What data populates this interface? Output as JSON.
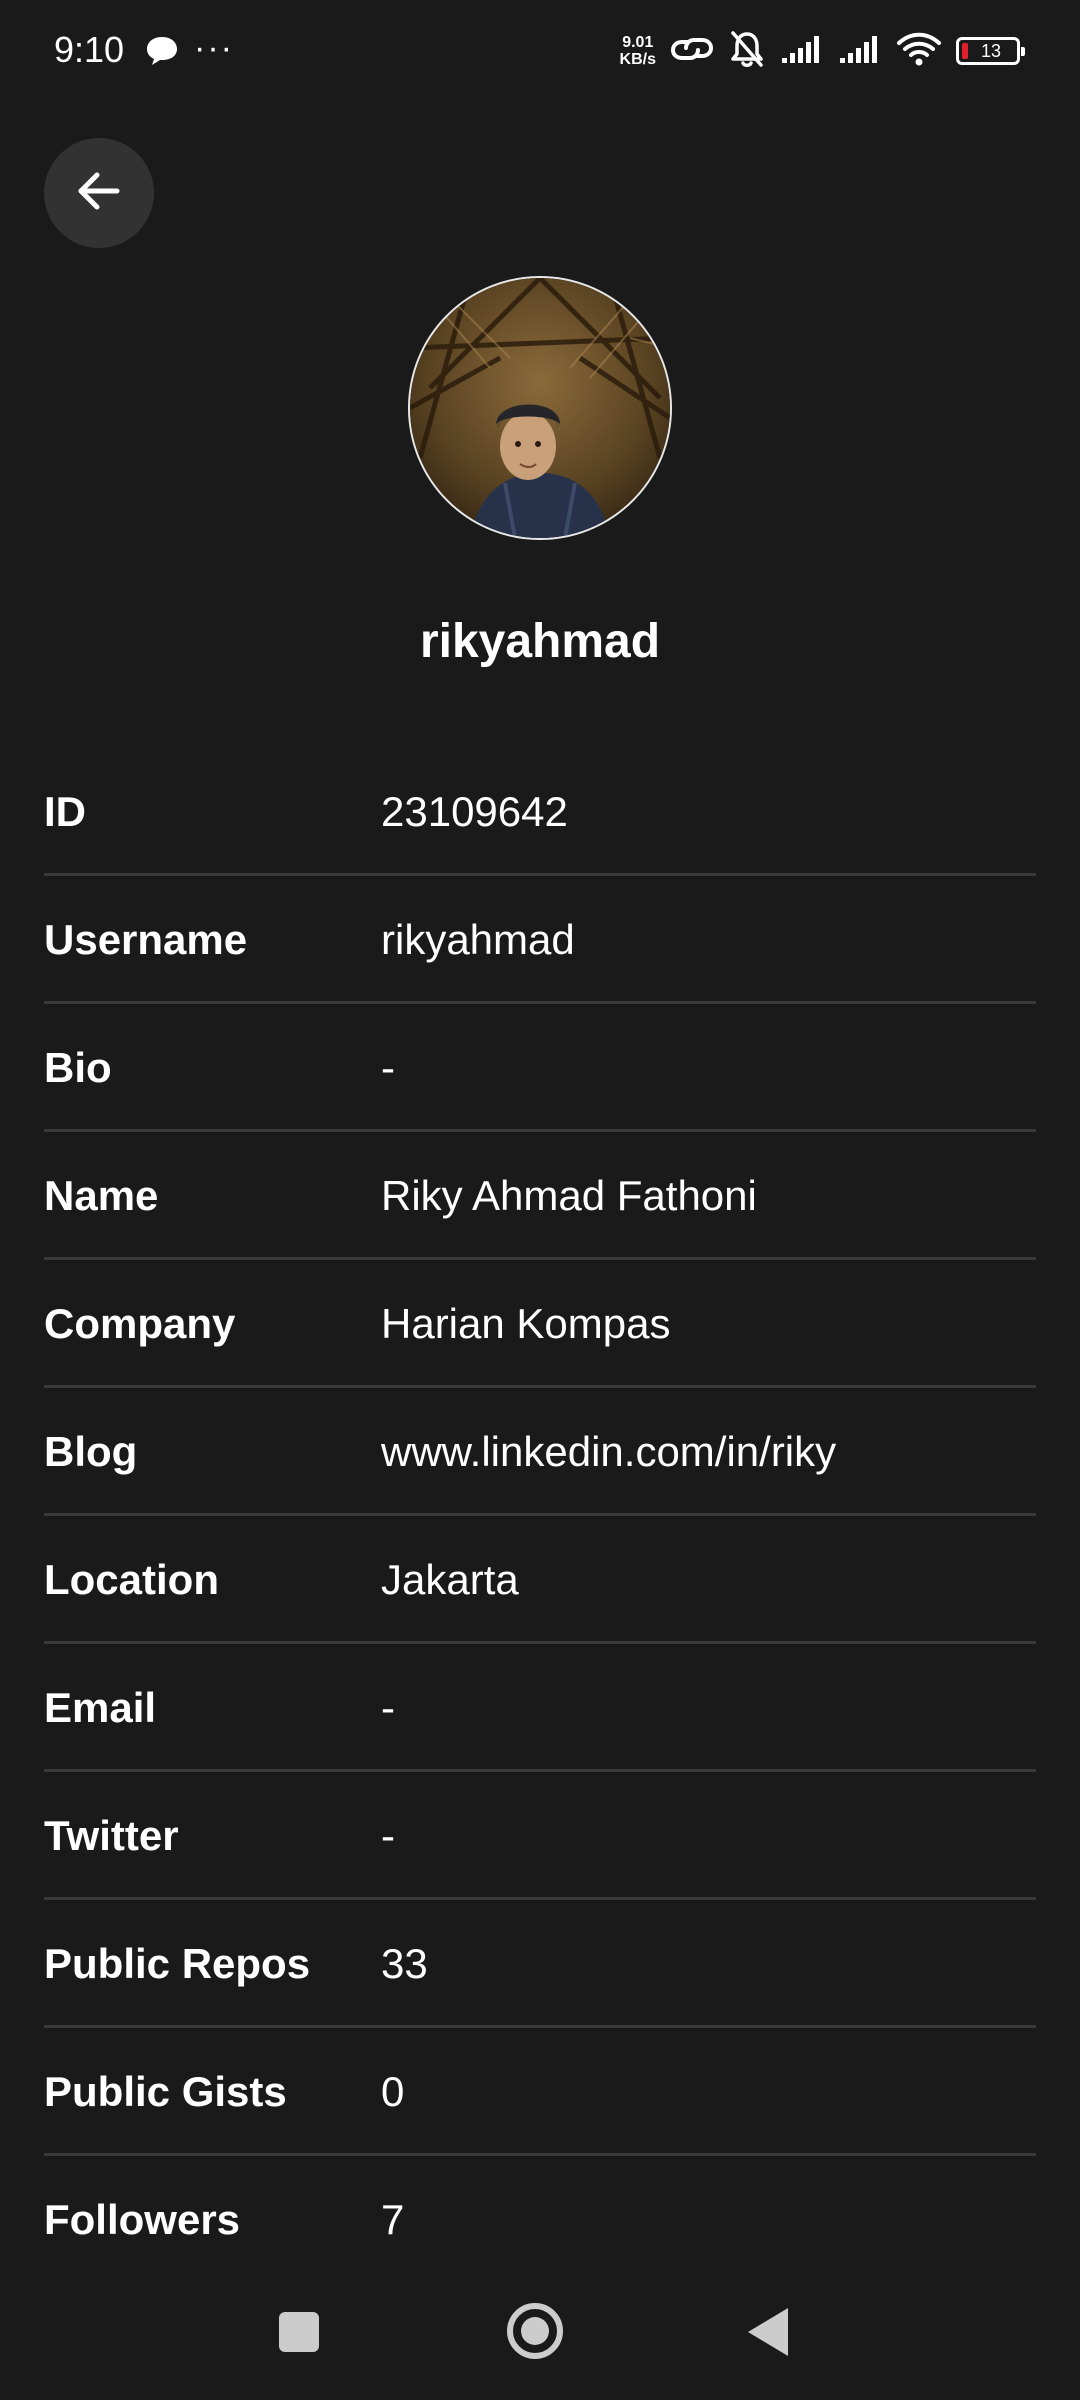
{
  "status_bar": {
    "time": "9:10",
    "more": "···",
    "net_speed_value": "9.01",
    "net_speed_unit": "KB/s",
    "battery": "13",
    "icons": [
      "chat-bubble-icon",
      "link-icon",
      "bell-off-icon",
      "signal-icon",
      "signal-icon",
      "wifi-icon",
      "battery-icon"
    ]
  },
  "header": {
    "back_icon": "arrow-left-icon"
  },
  "profile": {
    "username": "rikyahmad"
  },
  "details": [
    {
      "label": "ID",
      "value": "23109642"
    },
    {
      "label": "Username",
      "value": "rikyahmad"
    },
    {
      "label": "Bio",
      "value": "-"
    },
    {
      "label": "Name",
      "value": "Riky Ahmad Fathoni"
    },
    {
      "label": "Company",
      "value": "Harian Kompas"
    },
    {
      "label": "Blog",
      "value": "www.linkedin.com/in/riky"
    },
    {
      "label": "Location",
      "value": "Jakarta"
    },
    {
      "label": "Email",
      "value": "-"
    },
    {
      "label": "Twitter",
      "value": "-"
    },
    {
      "label": "Public Repos",
      "value": "33"
    },
    {
      "label": "Public Gists",
      "value": "0"
    },
    {
      "label": "Followers",
      "value": "7"
    }
  ],
  "nav_bar": {
    "icons": [
      "recents-square-icon",
      "home-circle-icon",
      "back-triangle-icon"
    ]
  }
}
